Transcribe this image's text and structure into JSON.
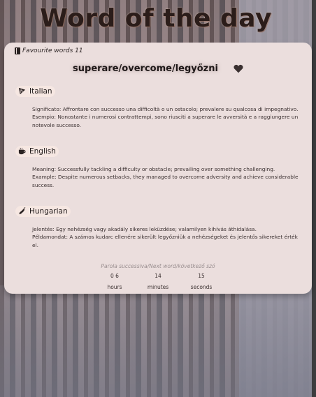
{
  "header": {
    "title": "Word of the day"
  },
  "favourites": {
    "label": "Favourite words 11"
  },
  "word": {
    "text": "superare/overcome/legyőzni"
  },
  "languages": [
    {
      "name": "Italian",
      "icon": "pizza-icon",
      "line1": "Significato: Affrontare con successo una difficoltà o un ostacolo; prevalere su qualcosa di impegnativo.",
      "line2": "Esempio: Nonostante i numerosi contrattempi, sono riusciti a superare le avversità e a raggiungere un notevole successo."
    },
    {
      "name": "English",
      "icon": "tea-cup-icon",
      "line1": "Meaning: Successfully tackling a difficulty or obstacle; prevailing over something challenging.",
      "line2": "Example: Despite numerous setbacks, they managed to overcome adversity and achieve considerable success."
    },
    {
      "name": "Hungarian",
      "icon": "pepper-icon",
      "line1": "Jelentés: Egy nehézség vagy akadály sikeres leküzdése; valamilyen kihívás áthidalása.",
      "line2": "Példamondat: A számos kudarc ellenére sikerült legyőzniük a nehézségeket és jelentős sikereket érték el."
    }
  ],
  "countdown": {
    "label": "Parola successiva/Next word/következő szó",
    "hours": "0 6",
    "minutes": "14",
    "seconds": "15",
    "hours_label": "hours",
    "minutes_label": "minutes",
    "seconds_label": "seconds"
  }
}
